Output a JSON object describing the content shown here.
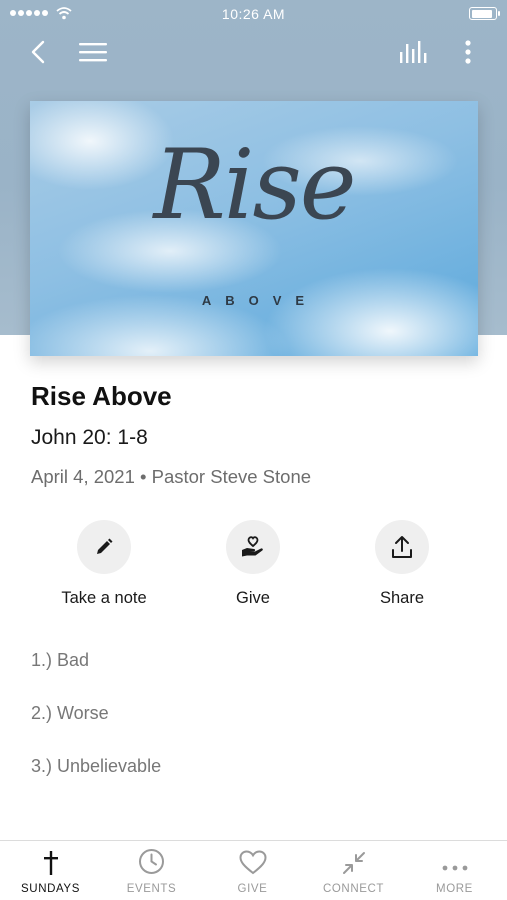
{
  "status_bar": {
    "time": "10:26 AM",
    "battery_level": 0.95
  },
  "nav": {
    "back_icon": "chevron-left-icon",
    "menu_icon": "hamburger-menu-icon",
    "audio_icon": "audio-bars-icon",
    "more_icon": "vertical-dots-icon"
  },
  "hero": {
    "script_title": "Rise",
    "subtitle": "ABOVE"
  },
  "sermon": {
    "title": "Rise Above",
    "scripture": "John 20: 1-8",
    "meta": "April 4, 2021 • Pastor Steve Stone"
  },
  "actions": [
    {
      "label": "Take a note",
      "icon": "pencil-icon"
    },
    {
      "label": "Give",
      "icon": "heart-hand-icon"
    },
    {
      "label": "Share",
      "icon": "share-icon"
    }
  ],
  "points": [
    "1.)  Bad",
    "2.)  Worse",
    "3.)  Unbelievable"
  ],
  "tabs": [
    {
      "label": "SUNDAYS",
      "icon": "cross-icon",
      "active": true
    },
    {
      "label": "EVENTS",
      "icon": "clock-icon",
      "active": false
    },
    {
      "label": "GIVE",
      "icon": "heart-icon",
      "active": false
    },
    {
      "label": "CONNECT",
      "icon": "connect-arrows-icon",
      "active": false
    },
    {
      "label": "MORE",
      "icon": "horizontal-dots-icon",
      "active": false
    }
  ],
  "colors": {
    "header_bg": "#9db5c8",
    "active_tab": "#111111",
    "inactive_tab": "#9a9a9a",
    "action_circle": "#efefef"
  }
}
